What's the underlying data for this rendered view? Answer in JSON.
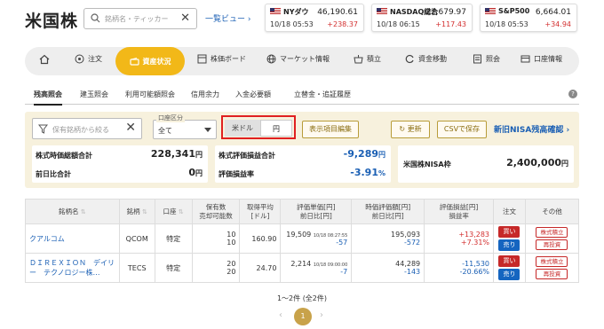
{
  "header": {
    "brand": "米国株",
    "search_placeholder": "銘柄名・ティッカー",
    "list_view": "一覧ビュー ›",
    "indices": [
      {
        "name": "NYダウ",
        "value": "46,190.61",
        "time": "10/18 05:53",
        "change": "+238.37"
      },
      {
        "name": "NASDAQ総合",
        "value": "22,679.97",
        "time": "10/18 06:15",
        "change": "+117.43"
      },
      {
        "name": "S&P500",
        "value": "6,664.01",
        "time": "10/18 05:53",
        "change": "+34.94"
      }
    ]
  },
  "nav": {
    "items": [
      "注文",
      "資産状況",
      "株価ボード",
      "マーケット情報",
      "積立",
      "資金移動",
      "照会",
      "口座情報"
    ]
  },
  "tabs": [
    "残高照会",
    "建玉照会",
    "利用可能額照会",
    "信用余力",
    "入金必要額",
    "立替金・追証履歴"
  ],
  "help": "?",
  "controls": {
    "filter_placeholder": "保有銘柄から絞る",
    "region_label": "口座区分",
    "region_value": "全て",
    "ccy_usd": "米ドル",
    "ccy_jpy": "円",
    "display_edit": "表示項目編集",
    "refresh": "更新",
    "csv": "CSVで保存",
    "nisa_link": "新旧NISA残高確認 ›"
  },
  "summary": {
    "market_value_label": "株式時価総額合計",
    "market_value": "228,341",
    "market_value_unit": "円",
    "prev_diff_label": "前日比合計",
    "prev_diff": "0",
    "prev_diff_unit": "円",
    "pl_label": "株式評価損益合計",
    "pl": "-9,289",
    "pl_unit": "円",
    "pl_rate_label": "評価損益率",
    "pl_rate": "-3.91",
    "pl_rate_unit": "%",
    "nisa_label": "米国株NISA枠",
    "nisa_value": "2,400,000",
    "nisa_unit": "円"
  },
  "table": {
    "headers": [
      "銘柄名",
      "銘柄",
      "口座",
      "保有数\n売却可能数",
      "取得平均\n[ドル]",
      "評価単価[円]\n前日比[円]",
      "時価評価額[円]\n前日比[円]",
      "評価損益[円]\n損益率",
      "注文",
      "その他"
    ],
    "rows": [
      {
        "name": "クアルコム",
        "ticker": "QCOM",
        "account": "特定",
        "qty": "10",
        "sellable": "10",
        "avg": "160.90",
        "price": "19,509",
        "price_time": "10/18 08:27:55",
        "price_diff": "-57",
        "value": "195,093",
        "value_diff": "-572",
        "pl": "+13,283",
        "pl_rate": "+7.31%",
        "buy": "買い",
        "sell": "売り",
        "o1": "株式積立",
        "o2": "再投資"
      },
      {
        "name": "ＤＩＲＥＸＩＯＮ　デイリー　テクノロジー株…",
        "ticker": "TECS",
        "account": "特定",
        "qty": "20",
        "sellable": "20",
        "avg": "24.70",
        "price": "2,214",
        "price_time": "10/18 09:00:00",
        "price_diff": "-7",
        "value": "44,289",
        "value_diff": "-143",
        "pl": "-11,530",
        "pl_rate": "-20.66%",
        "buy": "買い",
        "sell": "売り",
        "o1": "株式積立",
        "o2": "再投資"
      }
    ]
  },
  "pager": {
    "text": "1〜2件 (全2件)",
    "page": "1"
  },
  "colors": {
    "accent": "#f2b818",
    "positive": "#d32f2f",
    "negative": "#1a5fb4",
    "panel": "#f7f1dd"
  }
}
